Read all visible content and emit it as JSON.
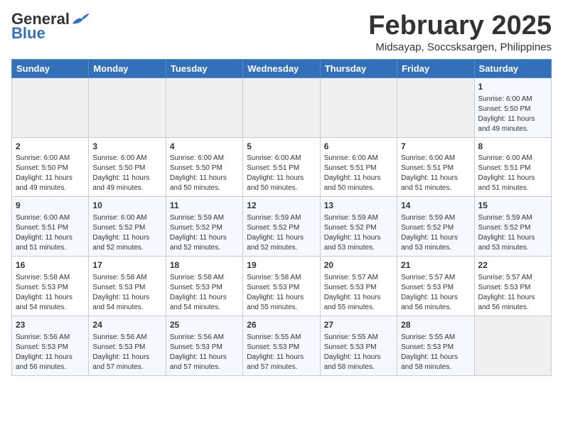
{
  "logo": {
    "general": "General",
    "blue": "Blue"
  },
  "title": "February 2025",
  "subtitle": "Midsayap, Soccsksargen, Philippines",
  "weekdays": [
    "Sunday",
    "Monday",
    "Tuesday",
    "Wednesday",
    "Thursday",
    "Friday",
    "Saturday"
  ],
  "weeks": [
    [
      {
        "day": "",
        "sunrise": "",
        "sunset": "",
        "daylight": ""
      },
      {
        "day": "",
        "sunrise": "",
        "sunset": "",
        "daylight": ""
      },
      {
        "day": "",
        "sunrise": "",
        "sunset": "",
        "daylight": ""
      },
      {
        "day": "",
        "sunrise": "",
        "sunset": "",
        "daylight": ""
      },
      {
        "day": "",
        "sunrise": "",
        "sunset": "",
        "daylight": ""
      },
      {
        "day": "",
        "sunrise": "",
        "sunset": "",
        "daylight": ""
      },
      {
        "day": "1",
        "sunrise": "Sunrise: 6:00 AM",
        "sunset": "Sunset: 5:50 PM",
        "daylight": "Daylight: 11 hours and 49 minutes."
      }
    ],
    [
      {
        "day": "2",
        "sunrise": "Sunrise: 6:00 AM",
        "sunset": "Sunset: 5:50 PM",
        "daylight": "Daylight: 11 hours and 49 minutes."
      },
      {
        "day": "3",
        "sunrise": "Sunrise: 6:00 AM",
        "sunset": "Sunset: 5:50 PM",
        "daylight": "Daylight: 11 hours and 49 minutes."
      },
      {
        "day": "4",
        "sunrise": "Sunrise: 6:00 AM",
        "sunset": "Sunset: 5:50 PM",
        "daylight": "Daylight: 11 hours and 50 minutes."
      },
      {
        "day": "5",
        "sunrise": "Sunrise: 6:00 AM",
        "sunset": "Sunset: 5:51 PM",
        "daylight": "Daylight: 11 hours and 50 minutes."
      },
      {
        "day": "6",
        "sunrise": "Sunrise: 6:00 AM",
        "sunset": "Sunset: 5:51 PM",
        "daylight": "Daylight: 11 hours and 50 minutes."
      },
      {
        "day": "7",
        "sunrise": "Sunrise: 6:00 AM",
        "sunset": "Sunset: 5:51 PM",
        "daylight": "Daylight: 11 hours and 51 minutes."
      },
      {
        "day": "8",
        "sunrise": "Sunrise: 6:00 AM",
        "sunset": "Sunset: 5:51 PM",
        "daylight": "Daylight: 11 hours and 51 minutes."
      }
    ],
    [
      {
        "day": "9",
        "sunrise": "Sunrise: 6:00 AM",
        "sunset": "Sunset: 5:51 PM",
        "daylight": "Daylight: 11 hours and 51 minutes."
      },
      {
        "day": "10",
        "sunrise": "Sunrise: 6:00 AM",
        "sunset": "Sunset: 5:52 PM",
        "daylight": "Daylight: 11 hours and 52 minutes."
      },
      {
        "day": "11",
        "sunrise": "Sunrise: 5:59 AM",
        "sunset": "Sunset: 5:52 PM",
        "daylight": "Daylight: 11 hours and 52 minutes."
      },
      {
        "day": "12",
        "sunrise": "Sunrise: 5:59 AM",
        "sunset": "Sunset: 5:52 PM",
        "daylight": "Daylight: 11 hours and 52 minutes."
      },
      {
        "day": "13",
        "sunrise": "Sunrise: 5:59 AM",
        "sunset": "Sunset: 5:52 PM",
        "daylight": "Daylight: 11 hours and 53 minutes."
      },
      {
        "day": "14",
        "sunrise": "Sunrise: 5:59 AM",
        "sunset": "Sunset: 5:52 PM",
        "daylight": "Daylight: 11 hours and 53 minutes."
      },
      {
        "day": "15",
        "sunrise": "Sunrise: 5:59 AM",
        "sunset": "Sunset: 5:52 PM",
        "daylight": "Daylight: 11 hours and 53 minutes."
      }
    ],
    [
      {
        "day": "16",
        "sunrise": "Sunrise: 5:58 AM",
        "sunset": "Sunset: 5:53 PM",
        "daylight": "Daylight: 11 hours and 54 minutes."
      },
      {
        "day": "17",
        "sunrise": "Sunrise: 5:58 AM",
        "sunset": "Sunset: 5:53 PM",
        "daylight": "Daylight: 11 hours and 54 minutes."
      },
      {
        "day": "18",
        "sunrise": "Sunrise: 5:58 AM",
        "sunset": "Sunset: 5:53 PM",
        "daylight": "Daylight: 11 hours and 54 minutes."
      },
      {
        "day": "19",
        "sunrise": "Sunrise: 5:58 AM",
        "sunset": "Sunset: 5:53 PM",
        "daylight": "Daylight: 11 hours and 55 minutes."
      },
      {
        "day": "20",
        "sunrise": "Sunrise: 5:57 AM",
        "sunset": "Sunset: 5:53 PM",
        "daylight": "Daylight: 11 hours and 55 minutes."
      },
      {
        "day": "21",
        "sunrise": "Sunrise: 5:57 AM",
        "sunset": "Sunset: 5:53 PM",
        "daylight": "Daylight: 11 hours and 56 minutes."
      },
      {
        "day": "22",
        "sunrise": "Sunrise: 5:57 AM",
        "sunset": "Sunset: 5:53 PM",
        "daylight": "Daylight: 11 hours and 56 minutes."
      }
    ],
    [
      {
        "day": "23",
        "sunrise": "Sunrise: 5:56 AM",
        "sunset": "Sunset: 5:53 PM",
        "daylight": "Daylight: 11 hours and 56 minutes."
      },
      {
        "day": "24",
        "sunrise": "Sunrise: 5:56 AM",
        "sunset": "Sunset: 5:53 PM",
        "daylight": "Daylight: 11 hours and 57 minutes."
      },
      {
        "day": "25",
        "sunrise": "Sunrise: 5:56 AM",
        "sunset": "Sunset: 5:53 PM",
        "daylight": "Daylight: 11 hours and 57 minutes."
      },
      {
        "day": "26",
        "sunrise": "Sunrise: 5:55 AM",
        "sunset": "Sunset: 5:53 PM",
        "daylight": "Daylight: 11 hours and 57 minutes."
      },
      {
        "day": "27",
        "sunrise": "Sunrise: 5:55 AM",
        "sunset": "Sunset: 5:53 PM",
        "daylight": "Daylight: 11 hours and 58 minutes."
      },
      {
        "day": "28",
        "sunrise": "Sunrise: 5:55 AM",
        "sunset": "Sunset: 5:53 PM",
        "daylight": "Daylight: 11 hours and 58 minutes."
      },
      {
        "day": "",
        "sunrise": "",
        "sunset": "",
        "daylight": ""
      }
    ]
  ]
}
